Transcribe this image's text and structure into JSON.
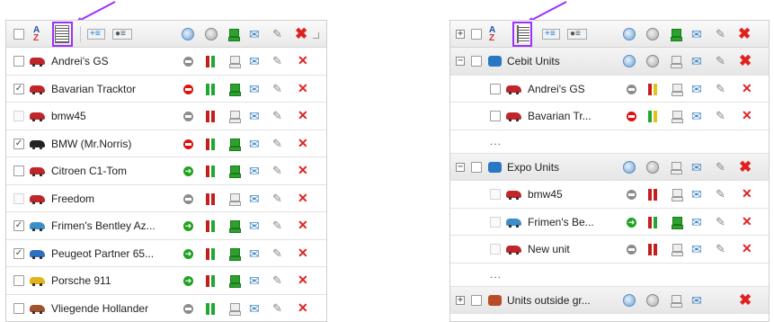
{
  "left_panel": {
    "rows": [
      {
        "name": "Andrei's GS",
        "checked": false,
        "dim": false,
        "car_color": "#c0252a",
        "status": "stop-gray",
        "bars": [
          "#c41f1f",
          "#22a832"
        ],
        "pc": false
      },
      {
        "name": "Bavarian Tracktor",
        "checked": true,
        "dim": false,
        "car_color": "#c0252a",
        "status": "stop-red",
        "bars": [
          "#22a832",
          "#22a832"
        ],
        "pc": true
      },
      {
        "name": "bmw45",
        "checked": false,
        "dim": true,
        "car_color": "#c0252a",
        "status": "stop-gray",
        "bars": [
          "#c41f1f",
          "#c41f1f"
        ],
        "pc": false
      },
      {
        "name": "BMW (Mr.Norris)",
        "checked": true,
        "dim": false,
        "car_color": "#222222",
        "status": "stop-red",
        "bars": [
          "#c41f1f",
          "#22a832"
        ],
        "pc": true
      },
      {
        "name": "Citroen C1-Tom",
        "checked": false,
        "dim": false,
        "car_color": "#c0252a",
        "status": "go-green",
        "bars": [
          "#c41f1f",
          "#22a832"
        ],
        "pc": true
      },
      {
        "name": "Freedom",
        "checked": false,
        "dim": true,
        "car_color": "#c0252a",
        "status": "stop-gray",
        "bars": [
          "#c41f1f",
          "#c41f1f"
        ],
        "pc": false
      },
      {
        "name": "Frimen's Bentley Az...",
        "checked": true,
        "dim": false,
        "car_color": "#3c8ec9",
        "status": "go-green",
        "bars": [
          "#c41f1f",
          "#22a832"
        ],
        "pc": true
      },
      {
        "name": "Peugeot Partner 65...",
        "checked": true,
        "dim": false,
        "car_color": "#2f6fc0",
        "status": "go-green",
        "bars": [
          "#c41f1f",
          "#22a832"
        ],
        "pc": true
      },
      {
        "name": "Porsche 911",
        "checked": false,
        "dim": false,
        "car_color": "#e2b41c",
        "status": "go-green",
        "bars": [
          "#c41f1f",
          "#22a832"
        ],
        "pc": true
      },
      {
        "name": "Vliegende Hollander",
        "checked": false,
        "dim": false,
        "car_color": "#a0522d",
        "status": "stop-gray",
        "bars": [
          "#22a832",
          "#22a832"
        ],
        "pc": false
      }
    ]
  },
  "right_panel": {
    "items": [
      {
        "kind": "group",
        "name": "Cebit Units",
        "expander": "−",
        "icon_color": "blue"
      },
      {
        "kind": "unit",
        "name": "Andrei's GS",
        "checked": false,
        "dim": false,
        "car_color": "#c0252a",
        "status": "stop-gray",
        "bars": [
          "#c41f1f",
          "#e4c21e"
        ],
        "pc": false
      },
      {
        "kind": "unit",
        "name": "Bavarian Tr...",
        "checked": false,
        "dim": false,
        "car_color": "#c0252a",
        "status": "stop-red",
        "bars": [
          "#22a832",
          "#e4c21e"
        ],
        "pc": false
      },
      {
        "kind": "ellipsis",
        "name": "..."
      },
      {
        "kind": "group",
        "name": "Expo Units",
        "expander": "−",
        "icon_color": "blue"
      },
      {
        "kind": "unit",
        "name": "bmw45",
        "checked": false,
        "dim": true,
        "car_color": "#c0252a",
        "status": "stop-gray",
        "bars": [
          "#c41f1f",
          "#c41f1f"
        ],
        "pc": false
      },
      {
        "kind": "unit",
        "name": "Frimen's Be...",
        "checked": false,
        "dim": true,
        "car_color": "#3c8ec9",
        "status": "go-green",
        "bars": [
          "#c41f1f",
          "#22a832"
        ],
        "pc": true
      },
      {
        "kind": "unit",
        "name": "New unit",
        "checked": false,
        "dim": true,
        "car_color": "#c0252a",
        "status": "stop-gray",
        "bars": [
          "#c41f1f",
          "#c41f1f"
        ],
        "pc": false
      },
      {
        "kind": "ellipsis",
        "name": "..."
      },
      {
        "kind": "group",
        "name": "Units outside gr...",
        "expander": "+",
        "icon_color": "red"
      }
    ]
  },
  "colors": {
    "highlight": "#9b30ff",
    "delete": "#e02020",
    "go": "#1fa21f",
    "stop": "#e01010"
  },
  "icons": {
    "toolbar": [
      "select-all-checkbox",
      "sort-az-icon",
      "list-view-icon",
      "add-group-icon",
      "visibility-icon",
      "command-icon",
      "gps-icon",
      "monitor-icon",
      "satellite-icon",
      "wrench-icon",
      "delete-icon",
      "resize-icon"
    ]
  }
}
